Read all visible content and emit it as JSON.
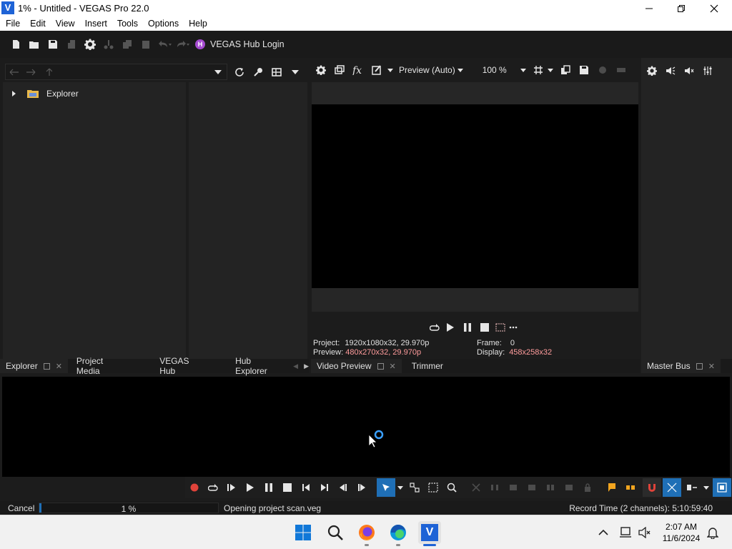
{
  "window": {
    "title": "1% - Untitled - VEGAS Pro 22.0",
    "app_letter": "V"
  },
  "menu": [
    "File",
    "Edit",
    "View",
    "Insert",
    "Tools",
    "Options",
    "Help"
  ],
  "toolbar": {
    "hub_badge": "H",
    "hub_login": "VEGAS Hub Login"
  },
  "explorer": {
    "tree": [
      {
        "label": "Explorer"
      }
    ]
  },
  "preview": {
    "quality": "Preview (Auto)",
    "zoom": "100 %",
    "project_label": "Project:",
    "project_value": "1920x1080x32, 29.970p",
    "preview_label": "Preview:",
    "preview_value": "480x270x32, 29.970p",
    "frame_label": "Frame:",
    "frame_value": "0",
    "display_label": "Display:",
    "display_value": "458x258x32"
  },
  "tabs": {
    "left": [
      "Explorer",
      "Project Media",
      "VEGAS Hub",
      "Hub Explorer"
    ],
    "middle": [
      "Video Preview",
      "Trimmer"
    ],
    "right": [
      "Master Bus"
    ]
  },
  "statusbar": {
    "cancel": "Cancel",
    "progress_text": "1 %",
    "progress": 0.01,
    "message": "Opening project scan.veg",
    "record_time": "Record Time (2 channels): 5:10:59:40"
  },
  "taskbar": {
    "time": "2:07 AM",
    "date": "11/6/2024",
    "apps": [
      "windows-start",
      "search",
      "firefox",
      "edge",
      "vegas"
    ]
  },
  "colors": {
    "accent": "#1f6fb6",
    "record": "#e0433a",
    "hub": "#a54bd0",
    "display_value": "#ff9c9c"
  }
}
